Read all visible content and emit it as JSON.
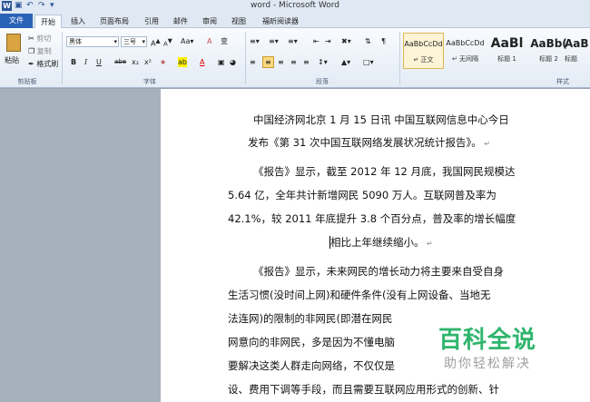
{
  "window": {
    "title": "word - Microsoft Word"
  },
  "tabs": [
    {
      "label": "文件"
    },
    {
      "label": "开始"
    },
    {
      "label": "插入"
    },
    {
      "label": "页面布局"
    },
    {
      "label": "引用"
    },
    {
      "label": "邮件"
    },
    {
      "label": "审阅"
    },
    {
      "label": "视图"
    },
    {
      "label": "福昕阅读器"
    }
  ],
  "clipboard": {
    "paste": "粘贴",
    "cut": "剪切",
    "copy": "复制",
    "format_painter": "格式刷",
    "label": "剪贴板"
  },
  "font": {
    "family": "黑体",
    "size": "三号",
    "label": "字体",
    "grow": "A",
    "shrink": "A",
    "case": "Aa",
    "clear": "A",
    "bold": "B",
    "italic": "I",
    "underline": "U",
    "strike": "abe",
    "sub": "x₂",
    "sup": "x²",
    "highlight": "ab",
    "color": "A"
  },
  "paragraph": {
    "label": "段落"
  },
  "styles": {
    "label": "样式",
    "items": [
      {
        "sample": "AaBbCcDd",
        "name": "↵ 正文"
      },
      {
        "sample": "AaBbCcDd",
        "name": "↵ 无间隔"
      },
      {
        "sample": "AaBl",
        "name": "标题 1"
      },
      {
        "sample": "AaBb(",
        "name": "标题 2"
      },
      {
        "sample": "AaB",
        "name": "标题"
      }
    ]
  },
  "document": {
    "paragraphs": [
      {
        "lines": [
          "中国经济网北京 1 月 15 日讯  中国互联网信息中心今日",
          "发布《第 31 次中国互联网络发展状况统计报告》。"
        ]
      },
      {
        "lines": [
          "《报告》显示，截至 2012 年 12 月底，我国网民规模达",
          "5.64 亿，全年共计新增网民 5090 万人。互联网普及率为",
          "42.1%，较 2011 年底提升 3.8 个百分点，普及率的增长幅度",
          "相比上年继续缩小。"
        ]
      },
      {
        "lines": [
          "《报告》显示，未来网民的增长动力将主要来自受自身",
          "生活习惯(没时间上网)和硬件条件(没有上网设备、当地无",
          "法连网)的限制的非网民(即潜在网民",
          "网意向的非网民，多是因为不懂电脑",
          "要解决这类人群走向网络，不仅仅是",
          "设、费用下调等手段，而且需要互联网应用形式的创新、针"
        ]
      }
    ]
  },
  "watermark": {
    "main": "百科全说",
    "sub": "助你轻松解决"
  },
  "colors": {
    "file_tab": "#2a62b8",
    "watermark_green": "#2fb56d"
  }
}
